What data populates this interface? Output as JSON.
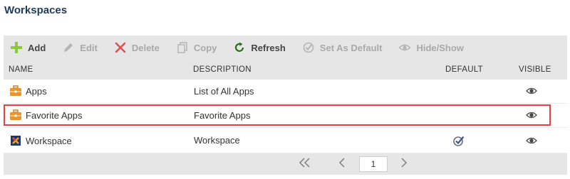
{
  "page": {
    "title": "Workspaces"
  },
  "toolbar": {
    "add": "Add",
    "edit": "Edit",
    "delete": "Delete",
    "copy": "Copy",
    "refresh": "Refresh",
    "set_default": "Set As Default",
    "hide_show": "Hide/Show"
  },
  "columns": {
    "name": "NAME",
    "description": "DESCRIPTION",
    "default": "DEFAULT",
    "visible": "VISIBLE"
  },
  "rows": [
    {
      "name": "Apps",
      "description": "List of All Apps",
      "icon": "briefcase-icon",
      "is_default": false,
      "visible": true
    },
    {
      "name": "Favorite Apps",
      "description": "Favorite Apps",
      "icon": "briefcase-icon",
      "is_default": false,
      "visible": true
    },
    {
      "name": "Workspace",
      "description": "Workspace",
      "icon": "workspace-logo-icon",
      "is_default": true,
      "visible": true
    }
  ],
  "pager": {
    "current_page": "1"
  },
  "colors": {
    "toolbar_bg": "#e6e6e6",
    "add_green": "#8dc63f",
    "delete_red": "#d9534f",
    "refresh_green": "#2e6b1f",
    "highlight_red": "#e8413e",
    "briefcase_orange": "#e8952e",
    "title_blue": "#1f3b5a"
  }
}
